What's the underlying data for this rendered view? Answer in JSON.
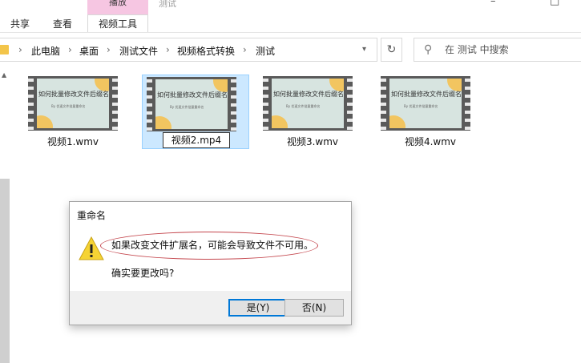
{
  "ribbon": {
    "tabs": [
      "共享",
      "查看"
    ],
    "context_header": "播放",
    "active_tab": "视频工具",
    "title_faint": "测试"
  },
  "address": {
    "crumbs": [
      "此电脑",
      "桌面",
      "测试文件",
      "视频格式转换",
      "测试"
    ]
  },
  "search": {
    "placeholder": "在 测试 中搜索"
  },
  "files": [
    {
      "name": "视频1.wmv",
      "slide_title": "如何批量修改文件后缀名?",
      "slide_sub": "By 优速文件批量重命名"
    },
    {
      "name": "视频2.mp4",
      "slide_title": "如何批量修改文件后缀名?",
      "slide_sub": "By 优速文件批量重命名"
    },
    {
      "name": "视频3.wmv",
      "slide_title": "如何批量修改文件后缀名?",
      "slide_sub": "By 优速文件批量重命名"
    },
    {
      "name": "视频4.wmv",
      "slide_title": "如何批量修改文件后缀名?",
      "slide_sub": "By 优速文件批量重命名"
    }
  ],
  "dialog": {
    "title": "重命名",
    "message": "如果改变文件扩展名，可能会导致文件不可用。",
    "question": "确实要更改吗?",
    "yes_label": "是(Y)",
    "no_label": "否(N)"
  },
  "colors": {
    "selection": "#cce8ff",
    "context_tab": "#f6c6e2",
    "annotation": "#c4464d",
    "primary_border": "#0078d7"
  }
}
